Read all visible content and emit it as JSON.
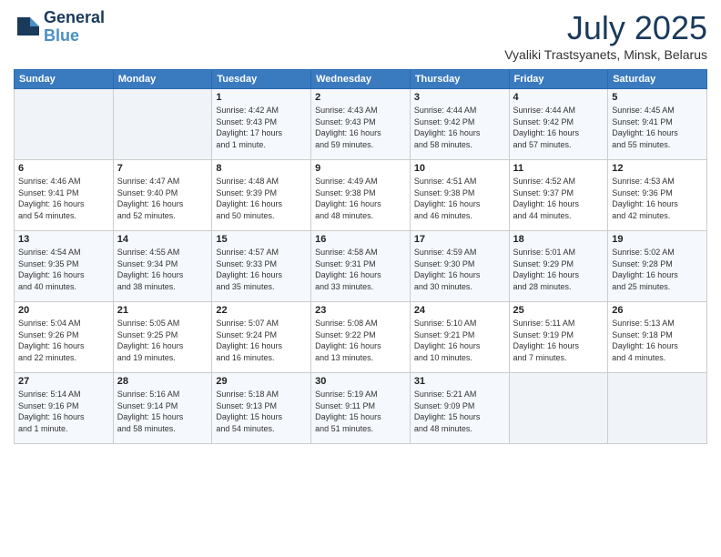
{
  "header": {
    "logo_line1": "General",
    "logo_line2": "Blue",
    "month_year": "July 2025",
    "location": "Vyaliki Trastsyanets, Minsk, Belarus"
  },
  "weekdays": [
    "Sunday",
    "Monday",
    "Tuesday",
    "Wednesday",
    "Thursday",
    "Friday",
    "Saturday"
  ],
  "weeks": [
    [
      {
        "day": "",
        "info": ""
      },
      {
        "day": "",
        "info": ""
      },
      {
        "day": "1",
        "info": "Sunrise: 4:42 AM\nSunset: 9:43 PM\nDaylight: 17 hours\nand 1 minute."
      },
      {
        "day": "2",
        "info": "Sunrise: 4:43 AM\nSunset: 9:43 PM\nDaylight: 16 hours\nand 59 minutes."
      },
      {
        "day": "3",
        "info": "Sunrise: 4:44 AM\nSunset: 9:42 PM\nDaylight: 16 hours\nand 58 minutes."
      },
      {
        "day": "4",
        "info": "Sunrise: 4:44 AM\nSunset: 9:42 PM\nDaylight: 16 hours\nand 57 minutes."
      },
      {
        "day": "5",
        "info": "Sunrise: 4:45 AM\nSunset: 9:41 PM\nDaylight: 16 hours\nand 55 minutes."
      }
    ],
    [
      {
        "day": "6",
        "info": "Sunrise: 4:46 AM\nSunset: 9:41 PM\nDaylight: 16 hours\nand 54 minutes."
      },
      {
        "day": "7",
        "info": "Sunrise: 4:47 AM\nSunset: 9:40 PM\nDaylight: 16 hours\nand 52 minutes."
      },
      {
        "day": "8",
        "info": "Sunrise: 4:48 AM\nSunset: 9:39 PM\nDaylight: 16 hours\nand 50 minutes."
      },
      {
        "day": "9",
        "info": "Sunrise: 4:49 AM\nSunset: 9:38 PM\nDaylight: 16 hours\nand 48 minutes."
      },
      {
        "day": "10",
        "info": "Sunrise: 4:51 AM\nSunset: 9:38 PM\nDaylight: 16 hours\nand 46 minutes."
      },
      {
        "day": "11",
        "info": "Sunrise: 4:52 AM\nSunset: 9:37 PM\nDaylight: 16 hours\nand 44 minutes."
      },
      {
        "day": "12",
        "info": "Sunrise: 4:53 AM\nSunset: 9:36 PM\nDaylight: 16 hours\nand 42 minutes."
      }
    ],
    [
      {
        "day": "13",
        "info": "Sunrise: 4:54 AM\nSunset: 9:35 PM\nDaylight: 16 hours\nand 40 minutes."
      },
      {
        "day": "14",
        "info": "Sunrise: 4:55 AM\nSunset: 9:34 PM\nDaylight: 16 hours\nand 38 minutes."
      },
      {
        "day": "15",
        "info": "Sunrise: 4:57 AM\nSunset: 9:33 PM\nDaylight: 16 hours\nand 35 minutes."
      },
      {
        "day": "16",
        "info": "Sunrise: 4:58 AM\nSunset: 9:31 PM\nDaylight: 16 hours\nand 33 minutes."
      },
      {
        "day": "17",
        "info": "Sunrise: 4:59 AM\nSunset: 9:30 PM\nDaylight: 16 hours\nand 30 minutes."
      },
      {
        "day": "18",
        "info": "Sunrise: 5:01 AM\nSunset: 9:29 PM\nDaylight: 16 hours\nand 28 minutes."
      },
      {
        "day": "19",
        "info": "Sunrise: 5:02 AM\nSunset: 9:28 PM\nDaylight: 16 hours\nand 25 minutes."
      }
    ],
    [
      {
        "day": "20",
        "info": "Sunrise: 5:04 AM\nSunset: 9:26 PM\nDaylight: 16 hours\nand 22 minutes."
      },
      {
        "day": "21",
        "info": "Sunrise: 5:05 AM\nSunset: 9:25 PM\nDaylight: 16 hours\nand 19 minutes."
      },
      {
        "day": "22",
        "info": "Sunrise: 5:07 AM\nSunset: 9:24 PM\nDaylight: 16 hours\nand 16 minutes."
      },
      {
        "day": "23",
        "info": "Sunrise: 5:08 AM\nSunset: 9:22 PM\nDaylight: 16 hours\nand 13 minutes."
      },
      {
        "day": "24",
        "info": "Sunrise: 5:10 AM\nSunset: 9:21 PM\nDaylight: 16 hours\nand 10 minutes."
      },
      {
        "day": "25",
        "info": "Sunrise: 5:11 AM\nSunset: 9:19 PM\nDaylight: 16 hours\nand 7 minutes."
      },
      {
        "day": "26",
        "info": "Sunrise: 5:13 AM\nSunset: 9:18 PM\nDaylight: 16 hours\nand 4 minutes."
      }
    ],
    [
      {
        "day": "27",
        "info": "Sunrise: 5:14 AM\nSunset: 9:16 PM\nDaylight: 16 hours\nand 1 minute."
      },
      {
        "day": "28",
        "info": "Sunrise: 5:16 AM\nSunset: 9:14 PM\nDaylight: 15 hours\nand 58 minutes."
      },
      {
        "day": "29",
        "info": "Sunrise: 5:18 AM\nSunset: 9:13 PM\nDaylight: 15 hours\nand 54 minutes."
      },
      {
        "day": "30",
        "info": "Sunrise: 5:19 AM\nSunset: 9:11 PM\nDaylight: 15 hours\nand 51 minutes."
      },
      {
        "day": "31",
        "info": "Sunrise: 5:21 AM\nSunset: 9:09 PM\nDaylight: 15 hours\nand 48 minutes."
      },
      {
        "day": "",
        "info": ""
      },
      {
        "day": "",
        "info": ""
      }
    ]
  ]
}
